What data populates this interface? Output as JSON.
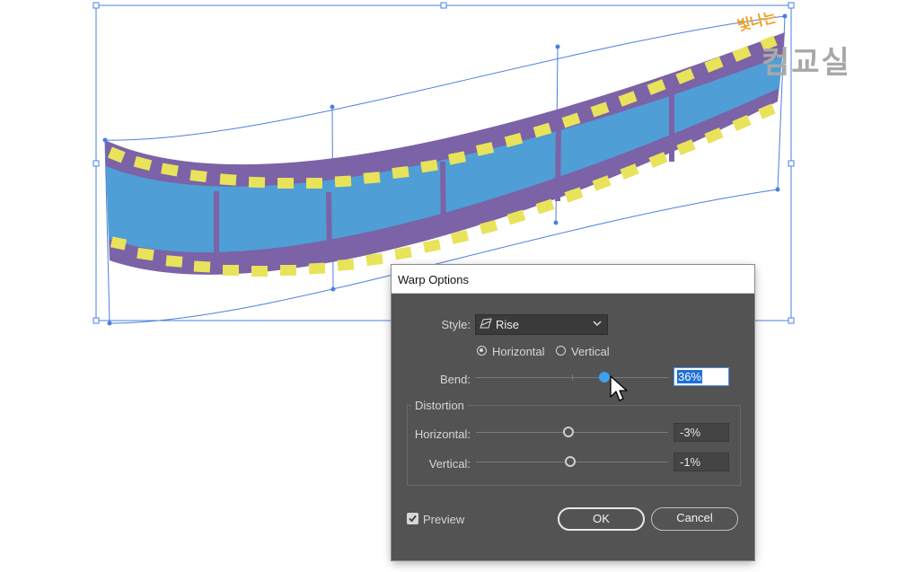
{
  "watermark": {
    "top_text": "빛나는",
    "main_text": "컴교실"
  },
  "dialog": {
    "title": "Warp Options",
    "style_label": "Style:",
    "style_value": "Rise",
    "orientation": {
      "horizontal": "Horizontal",
      "vertical": "Vertical",
      "selected": "Horizontal"
    },
    "bend": {
      "label": "Bend:",
      "value": "36%",
      "level": 0.68
    },
    "distortion": {
      "title": "Distortion",
      "horizontal": {
        "label": "Horizontal:",
        "value": "-3%",
        "level": 0.485
      },
      "vertical": {
        "label": "Vertical:",
        "value": "-1%",
        "level": 0.495
      }
    },
    "preview": {
      "label": "Preview",
      "checked": true
    },
    "ok_label": "OK",
    "cancel_label": "Cancel"
  },
  "colors": {
    "film_blue": "#4f9ed6",
    "film_purple": "#7c62a6",
    "sprocket_yellow": "#e8e35a",
    "selection_blue": "#4a7fe0",
    "dialog_bg": "#535353"
  }
}
